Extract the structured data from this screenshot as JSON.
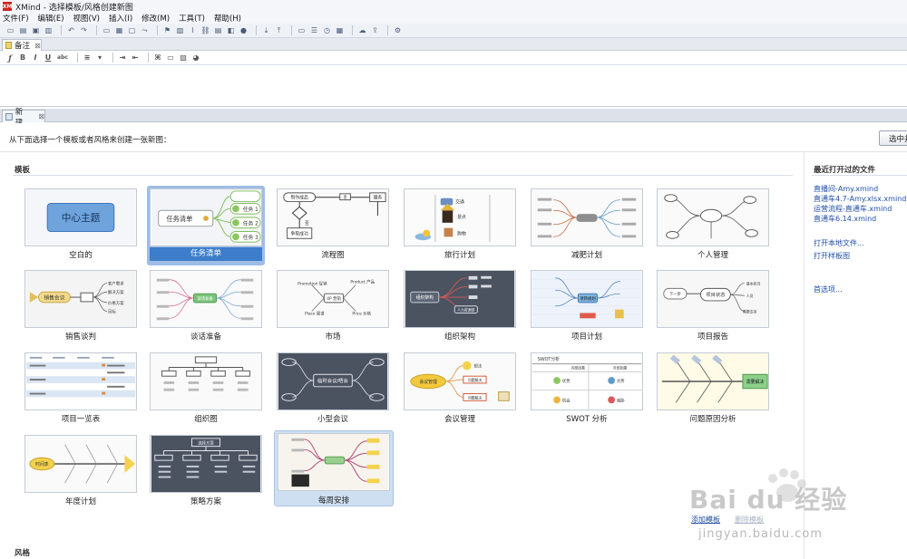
{
  "window": {
    "title": "XMind - 选择模板/风格创建新图",
    "app_icon": "XM"
  },
  "menu": [
    "文件(F)",
    "编辑(E)",
    "视图(V)",
    "插入(I)",
    "修改(M)",
    "工具(T)",
    "帮助(H)"
  ],
  "notes_tab": {
    "label": "备注",
    "close": "⊠"
  },
  "editor_tab": {
    "label": "新建...",
    "close": "⊠"
  },
  "instruction": "从下面选择一个模板或者风格来创建一张新图：",
  "create_button": "选中并",
  "sections": {
    "templates": "模板",
    "styles": "风格"
  },
  "templates": [
    {
      "label": "空白的",
      "center_text": "中心主题"
    },
    {
      "label": "任务清单",
      "center_text": "任务清单",
      "items": [
        "任务 1",
        "任务 2",
        "任务 3"
      ]
    },
    {
      "label": "流程图",
      "nodes": [
        "制作成品",
        "是",
        "否",
        "服务",
        "争取成功"
      ]
    },
    {
      "label": "旅行计划",
      "nodes": [
        "交通",
        "景点",
        "购物"
      ]
    },
    {
      "label": "减肥计划"
    },
    {
      "label": "个人管理"
    },
    {
      "label": "销售谈判",
      "center_text": "销售会议",
      "nodes": [
        "目标",
        "客户需求",
        "解决方案",
        "价格方案"
      ]
    },
    {
      "label": "谈话准备",
      "center_text": "谈话准备"
    },
    {
      "label": "市场",
      "nodes": [
        "Promotion 促销",
        "Product 产品",
        "4P 营销",
        "Place 渠道",
        "Price 价格"
      ]
    },
    {
      "label": "组织架构",
      "center_text": "组织架构",
      "nodes": [
        "人力资源部"
      ]
    },
    {
      "label": "项目计划",
      "center_text": "项目规划"
    },
    {
      "label": "项目报告",
      "center_text": "项目状态",
      "nodes": [
        "下一步",
        "基本状况",
        "人员",
        "需要支持"
      ]
    },
    {
      "label": "项目一览表"
    },
    {
      "label": "组织图"
    },
    {
      "label": "小型会议",
      "center_text": "临时会议/晤会"
    },
    {
      "label": "会议管理",
      "center_text": "会议管理",
      "nodes": [
        "想法",
        "问题解决",
        "问题解决"
      ]
    },
    {
      "label": "SWOT 分析",
      "center_text": "SWOT分析",
      "nodes": [
        "内部因素",
        "外部因素",
        "优势",
        "劣势",
        "机会",
        "威胁"
      ]
    },
    {
      "label": "问题原因分析",
      "center_text": "需要解决"
    },
    {
      "label": "年度计划",
      "center_text": "时间表"
    },
    {
      "label": "策略方案",
      "center_text": "选择方案"
    },
    {
      "label": "每周安排"
    }
  ],
  "recent": {
    "title": "最近打开过的文件",
    "files": [
      "直播间-Amy.xmind",
      "直通车4.7-Amy.xlsx.xmind",
      "运营流程-直通车.xmind",
      "直通车6.14.xmind"
    ],
    "actions": [
      "打开本地文件...",
      "打开样板图",
      "首选项..."
    ]
  },
  "bottom_links": [
    "添加模板",
    "删除模板"
  ],
  "watermark": {
    "brand": "Bai du 经验",
    "url": "jingyan.baidu.com"
  },
  "colors": {
    "selected": "#3d7dc9",
    "link": "#1f4ea8",
    "app_red": "#c8251f"
  }
}
